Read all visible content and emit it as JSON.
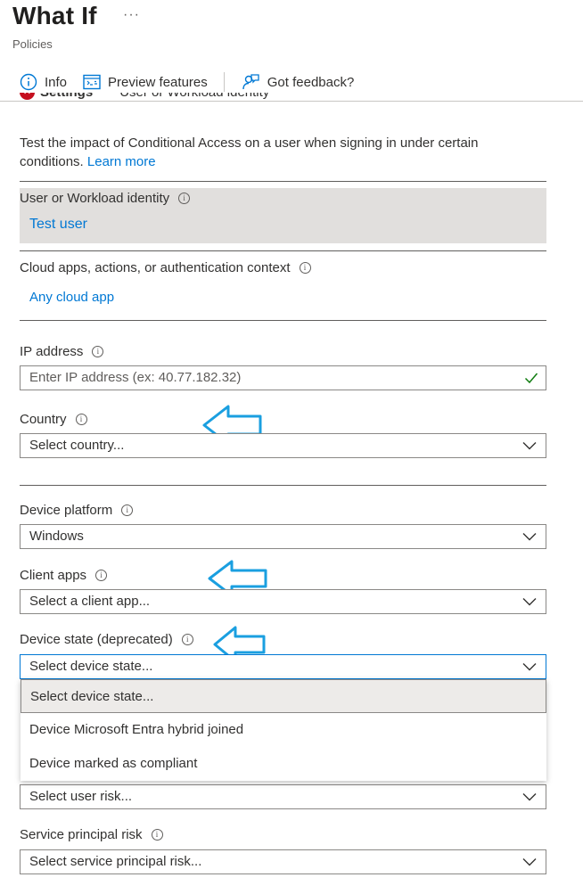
{
  "header": {
    "title": "What If",
    "more": "···",
    "subtitle": "Policies"
  },
  "toolbar": {
    "info": "Info",
    "preview": "Preview features",
    "feedback": "Got feedback?"
  },
  "tabs": {
    "settings": "Settings",
    "identity": "User or Workload identity"
  },
  "description": {
    "text": "Test the impact of Conditional Access on a user when signing in under certain conditions.",
    "learn_more": "Learn more"
  },
  "identity": {
    "label": "User or Workload identity",
    "value": "Test user"
  },
  "cloud_apps": {
    "label": "Cloud apps, actions, or authentication context",
    "value": "Any cloud app"
  },
  "ip": {
    "label": "IP address",
    "placeholder": "Enter IP address (ex: 40.77.182.32)"
  },
  "country": {
    "label": "Country",
    "value": "Select country..."
  },
  "platform": {
    "label": "Device platform",
    "value": "Windows"
  },
  "client_apps": {
    "label": "Client apps",
    "value": "Select a client app..."
  },
  "device_state": {
    "label": "Device state (deprecated)",
    "value": "Select device state...",
    "options": [
      "Select device state...",
      "Device Microsoft Entra hybrid joined",
      "Device marked as compliant"
    ]
  },
  "user_risk": {
    "value": "Select user risk..."
  },
  "sp_risk": {
    "label": "Service principal risk",
    "value": "Select service principal risk..."
  },
  "colors": {
    "accent": "#0078d4",
    "annotation_arrow": "#1a9fe0",
    "error": "#c50f1f"
  }
}
